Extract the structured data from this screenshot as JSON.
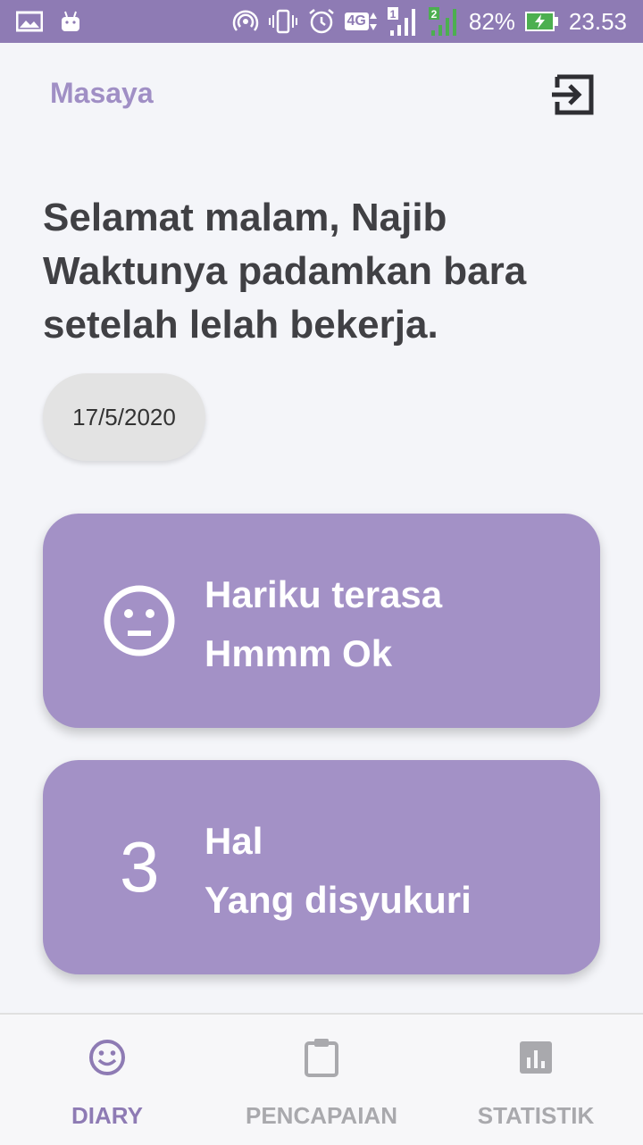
{
  "status_bar": {
    "signal_4g": "4G",
    "sim1": "1",
    "sim2": "2",
    "battery": "82%",
    "time": "23.53"
  },
  "header": {
    "app_name": "Masaya",
    "exit_icon": "exit-icon"
  },
  "greeting": {
    "line1": "Selamat malam, Najib",
    "line2": "Waktunya padamkan bara",
    "line3": "setelah lelah bekerja."
  },
  "date": "17/5/2020",
  "mood_card": {
    "icon": "neutral-face-icon",
    "line1": "Hariku terasa",
    "line2": "Hmmm Ok"
  },
  "gratitude_card": {
    "count": "3",
    "line1": "Hal",
    "line2": "Yang disyukuri"
  },
  "bottom_nav": {
    "items": [
      {
        "label": "DIARY",
        "icon": "smiley-icon",
        "active": true
      },
      {
        "label": "PENCAPAIAN",
        "icon": "clipboard-icon",
        "active": false
      },
      {
        "label": "STATISTIK",
        "icon": "bar-chart-icon",
        "active": false
      }
    ]
  },
  "colors": {
    "accent": "#8e7bb4",
    "card": "#a391c6",
    "text_dark": "#404044",
    "inactive": "#a9a9ad"
  }
}
